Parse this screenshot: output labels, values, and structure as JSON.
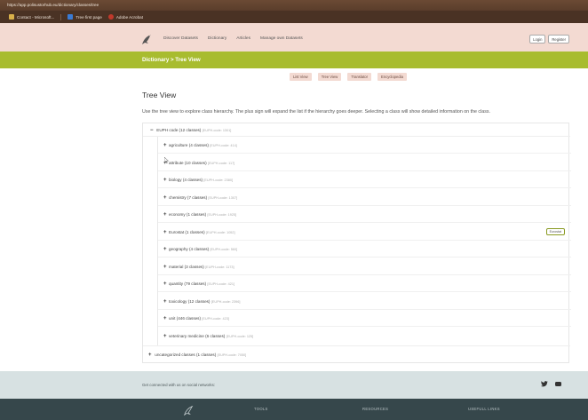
{
  "browser": {
    "url": "https://app.polisustorhub.eu/dictionary/classes/tree",
    "bookmarks": [
      {
        "label": "Contact - Microsoft..."
      },
      {
        "label": "Tree first page"
      },
      {
        "label": "Adobe Acrobat"
      }
    ]
  },
  "header": {
    "logo_icon": "bird-logo-icon",
    "nav": [
      "Discover Datasets",
      "Dictionary",
      "Articles",
      "Manage own Datasets"
    ],
    "login_label": "Login",
    "register_label": "Register",
    "colors": {
      "header_bg": "#f3dad2",
      "accent": "#a8bc2f"
    }
  },
  "breadcrumb": "Dictionary > Tree View",
  "view_tabs": [
    "List View",
    "Tree View",
    "Translator",
    "Encyclopedia"
  ],
  "page": {
    "title": "Tree View",
    "description": "Use the tree view to explore class hierarchy. The plus sign will expand the list if the hierarchy goes deeper. Selecting a class will show detailed information on the class."
  },
  "tree": {
    "root": {
      "sign": "−",
      "label": "EUPH code (12 classes)",
      "code": "[EUPH-code: 1301]"
    },
    "children": [
      {
        "sign": "+",
        "label": "agriculture (4 classes)",
        "code": "[EUPH-code: 414]"
      },
      {
        "sign": "+",
        "label": "attribute (10 classes)",
        "code": "[EUPH-code: 117]"
      },
      {
        "sign": "+",
        "label": "biology (4 classes)",
        "code": "[EUPH-code: 2380]"
      },
      {
        "sign": "+",
        "label": "chemistry (7 classes)",
        "code": "[EUPH-code: 1307]"
      },
      {
        "sign": "+",
        "label": "economy (1 classes)",
        "code": "[EUPH-code: 1925]"
      },
      {
        "sign": "+",
        "label": "Eurostat (1 classes)",
        "code": "[EUPH-code: 1052]",
        "button": "Eurostat"
      },
      {
        "sign": "+",
        "label": "geography (4 classes)",
        "code": "[EUPH-code: 560]"
      },
      {
        "sign": "+",
        "label": "material (3 classes)",
        "code": "[EUPH-code: 1173]"
      },
      {
        "sign": "+",
        "label": "quantity (79 classes)",
        "code": "[EUPH-code: 421]"
      },
      {
        "sign": "+",
        "label": "toxicology (12 classes)",
        "code": "[EUPH-code: 2396]"
      },
      {
        "sign": "+",
        "label": "unit (446 classes)",
        "code": "[EUPH-code: 423]"
      },
      {
        "sign": "+",
        "label": "veterinary medicine (6 classes)",
        "code": "[EUPH-code: 125]"
      }
    ],
    "uncategorized": {
      "sign": "+",
      "label": "uncategorized classes (1 classes)",
      "code": "[EUPH-code: 7050]"
    }
  },
  "footer": {
    "social_text": "Get connected with us on social networks:",
    "social_icons": [
      "twitter-icon",
      "youtube-icon"
    ],
    "logo_icon": "bird-logo-icon",
    "headings": [
      "TOOLS",
      "RESOURCES",
      "USEFULL LINKS"
    ]
  }
}
